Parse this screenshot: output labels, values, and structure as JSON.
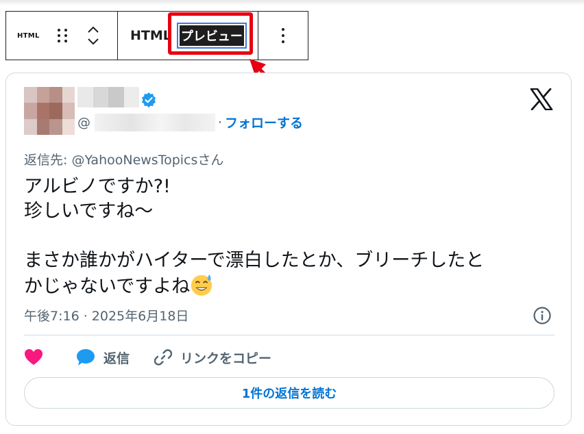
{
  "toolbar": {
    "block_icon_label": "HTML",
    "tab_html_label": "HTML",
    "tab_preview_label": "プレビュー"
  },
  "post": {
    "handle_prefix": "@",
    "follow_label": "フォローする",
    "reply_to": "返信先: @YahooNewsTopicsさん",
    "text_lines": [
      "アルビノですか?!",
      "珍しいですね〜",
      "",
      "まさか誰かがハイターで漂白したとか、ブリーチしたと",
      "かじゃないですよね"
    ],
    "timestamp": "午後7:16 · 2025年6月18日",
    "actions": {
      "reply_label": "返信",
      "copy_link_label": "リンクをコピー"
    },
    "read_replies_label": "1件の返信を読む"
  },
  "colors": {
    "accent_blue": "#0074d4",
    "highlight_red": "#e60012",
    "like_pink": "#f91880",
    "reply_blue": "#1d9bf0",
    "muted_text": "#536471"
  },
  "icons": [
    "html-block-icon",
    "drag-handle-icon",
    "move-up-icon",
    "move-down-icon",
    "more-options-icon",
    "verified-badge-icon",
    "x-logo-icon",
    "info-icon",
    "heart-icon",
    "reply-bubble-icon",
    "link-icon",
    "sweat-smile-emoji"
  ]
}
